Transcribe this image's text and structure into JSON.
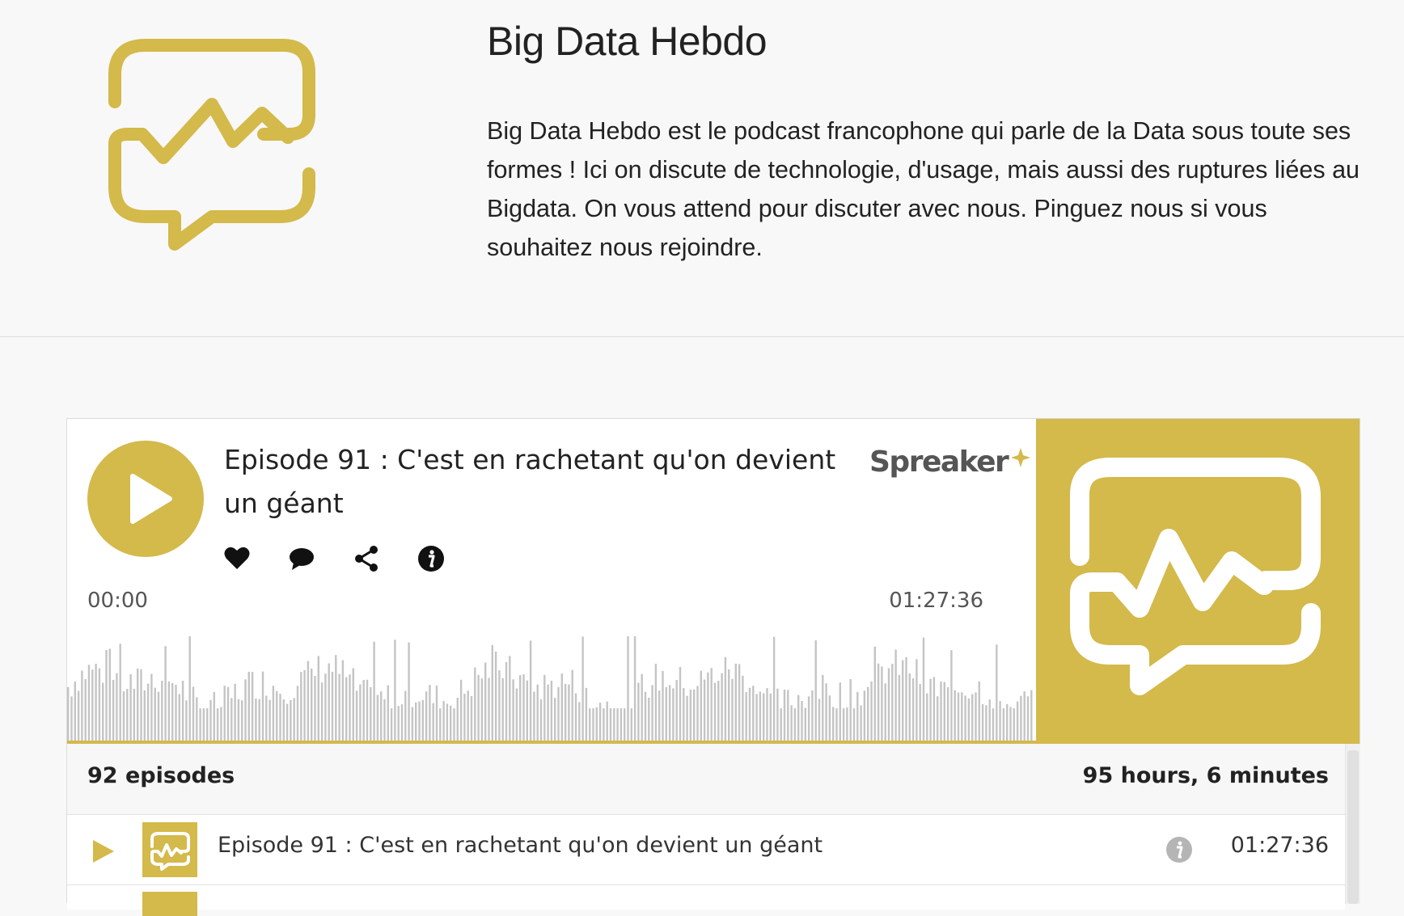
{
  "podcast": {
    "title": "Big Data Hebdo",
    "description": "Big Data Hebdo est le podcast francophone qui parle de la Data sous toute ses formes ! Ici on discute de technologie, d'usage, mais aussi des ruptures liées au Bigdata. On vous attend pour discuter avec nous. Pinguez nous si vous souhaitez nous rejoindre.",
    "logo_icon": "chat-bubble-heartbeat-icon",
    "brand_color": "#d4b94b"
  },
  "player": {
    "episode_title": "Episode 91 : C'est en rachetant qu'on devient un géant",
    "brand": "Spreaker",
    "time_current": "00:00",
    "time_total": "01:27:36",
    "progress": 0,
    "actions": [
      {
        "name": "like",
        "icon": "heart-icon"
      },
      {
        "name": "comment",
        "icon": "comment-icon"
      },
      {
        "name": "share",
        "icon": "share-icon"
      },
      {
        "name": "info",
        "icon": "info-icon"
      }
    ]
  },
  "stats": {
    "episode_count": "92 episodes",
    "total_duration": "95 hours, 6 minutes"
  },
  "episodes": [
    {
      "title": "Episode 91 : C'est en rachetant qu'on devient un géant",
      "duration": "01:27:36"
    }
  ]
}
